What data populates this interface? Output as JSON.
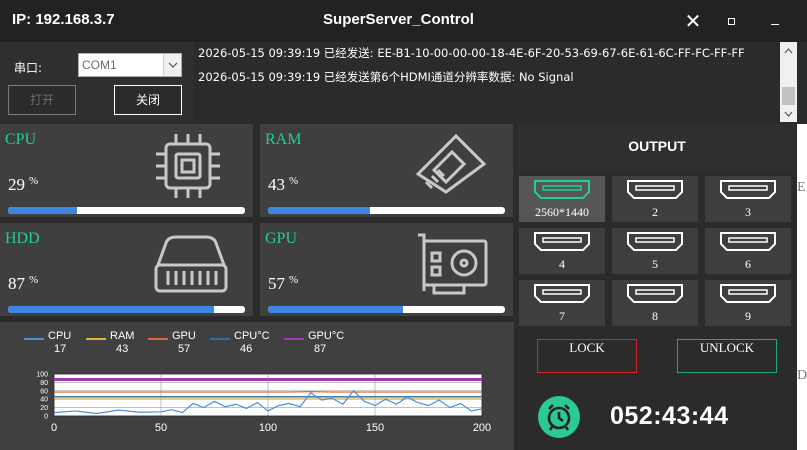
{
  "window": {
    "ip_text": "IP: 192.168.3.7",
    "title": "SuperServer_Control",
    "close_glyph": "✕"
  },
  "serial": {
    "label": "串口:",
    "port_value": "COM1",
    "open_label": "打开",
    "close_label": "关闭"
  },
  "log": {
    "lines": [
      "2026-05-15 09:39:19  已经发送: EE-B1-10-00-00-00-18-4E-6F-20-53-69-67-6E-61-6C-FF-FC-FF-FF",
      "2026-05-15 09:39:19  已经发送第6个HDMI通道分辨率数据: No Signal"
    ]
  },
  "monitors": [
    {
      "name": "CPU",
      "value": "29",
      "unit": "%",
      "percent": 29,
      "icon": "cpu-chip-icon"
    },
    {
      "name": "RAM",
      "value": "43",
      "unit": "%",
      "percent": 43,
      "icon": "ram-stick-icon"
    },
    {
      "name": "HDD",
      "value": "87",
      "unit": "%",
      "percent": 87,
      "icon": "hdd-drive-icon"
    },
    {
      "name": "GPU",
      "value": "57",
      "unit": "%",
      "percent": 57,
      "icon": "gpu-card-icon"
    }
  ],
  "chart_data": {
    "type": "line",
    "legend": [
      {
        "name": "CPU",
        "value": "17",
        "color": "#4a8fe0"
      },
      {
        "name": "RAM",
        "value": "43",
        "color": "#e8b13a"
      },
      {
        "name": "GPU",
        "value": "57",
        "color": "#e06a3a"
      },
      {
        "name": "CPU°C",
        "value": "46",
        "color": "#2a6fa8"
      },
      {
        "name": "GPU°C",
        "value": "87",
        "color": "#a03ab0"
      }
    ],
    "xlim": [
      0,
      200
    ],
    "ylim": [
      0,
      100
    ],
    "x_ticks": [
      "0",
      "50",
      "100",
      "150",
      "200"
    ],
    "y_ticks": [
      "0",
      "20",
      "40",
      "60",
      "80",
      "100"
    ],
    "grid": true,
    "series": [
      {
        "name": "CPU",
        "color": "#4a8fe0",
        "x": [
          0,
          10,
          20,
          30,
          40,
          50,
          55,
          60,
          65,
          70,
          75,
          80,
          85,
          90,
          95,
          100,
          105,
          110,
          115,
          120,
          125,
          130,
          135,
          140,
          145,
          150,
          155,
          160,
          165,
          170,
          175,
          180,
          185,
          190,
          195,
          200
        ],
        "values": [
          8,
          12,
          6,
          14,
          9,
          10,
          15,
          8,
          30,
          20,
          35,
          22,
          28,
          18,
          32,
          12,
          25,
          30,
          22,
          55,
          38,
          42,
          28,
          60,
          35,
          25,
          40,
          28,
          45,
          32,
          25,
          38,
          20,
          30,
          12,
          17
        ]
      },
      {
        "name": "RAM",
        "color": "#e8b13a",
        "x": [
          0,
          200
        ],
        "values": [
          43,
          43
        ]
      },
      {
        "name": "GPU",
        "color": "#e06a3a",
        "x": [
          0,
          100,
          110,
          120,
          130,
          140,
          150,
          160,
          170,
          180,
          190,
          200
        ],
        "values": [
          57,
          57,
          57,
          58,
          57,
          57,
          57,
          57,
          57,
          57,
          57,
          57
        ]
      },
      {
        "name": "CPU°C",
        "color": "#2a6fa8",
        "x": [
          0,
          50,
          100,
          150,
          200
        ],
        "values": [
          46,
          46,
          46,
          46,
          46
        ]
      },
      {
        "name": "GPU°C",
        "color": "#a03ab0",
        "x": [
          0,
          200
        ],
        "values": [
          87,
          87
        ]
      }
    ]
  },
  "output": {
    "title": "OUTPUT",
    "tiles": [
      {
        "label": "2560*1440",
        "active": true
      },
      {
        "label": "2",
        "active": false
      },
      {
        "label": "3",
        "active": false
      },
      {
        "label": "4",
        "active": false
      },
      {
        "label": "5",
        "active": false
      },
      {
        "label": "6",
        "active": false
      },
      {
        "label": "7",
        "active": false
      },
      {
        "label": "8",
        "active": false
      },
      {
        "label": "9",
        "active": false
      }
    ],
    "lock_label": "LOCK",
    "unlock_label": "UNLOCK",
    "timer": "052:43:44"
  },
  "edge_text": [
    "E",
    "D"
  ],
  "colors": {
    "accent_green": "#20d08f",
    "bar_blue": "#3e86e1",
    "lock_red": "#d62424",
    "unlock_green": "#23a96b"
  }
}
